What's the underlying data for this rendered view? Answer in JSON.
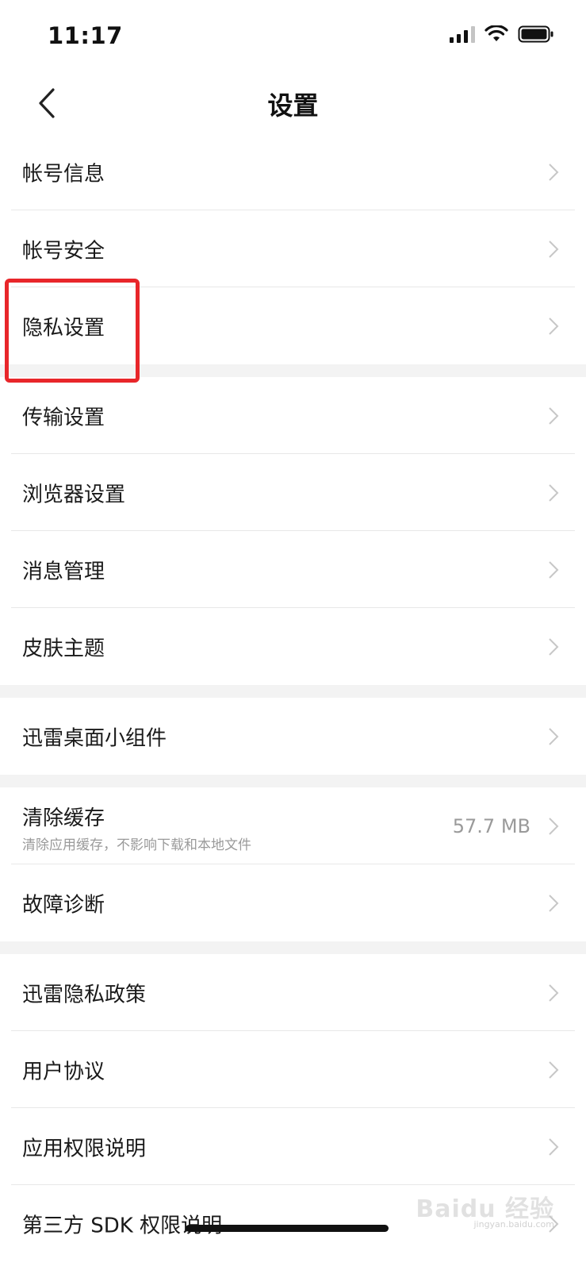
{
  "status_bar": {
    "time": "11:17"
  },
  "nav": {
    "title": "设置",
    "back_icon": "chevron-left-icon"
  },
  "groups": [
    {
      "items": [
        {
          "label": "帐号信息"
        },
        {
          "label": "帐号安全"
        },
        {
          "label": "隐私设置",
          "highlighted": true
        }
      ]
    },
    {
      "items": [
        {
          "label": "传输设置"
        },
        {
          "label": "浏览器设置"
        },
        {
          "label": "消息管理"
        },
        {
          "label": "皮肤主题"
        }
      ]
    },
    {
      "items": [
        {
          "label": "迅雷桌面小组件"
        }
      ]
    },
    {
      "items": [
        {
          "label": "清除缓存",
          "sublabel": "清除应用缓存，不影响下载和本地文件",
          "value": "57.7 MB"
        },
        {
          "label": "故障诊断"
        }
      ]
    },
    {
      "items": [
        {
          "label": "迅雷隐私政策"
        },
        {
          "label": "用户协议"
        },
        {
          "label": "应用权限说明"
        },
        {
          "label": "第三方 SDK 权限说明"
        }
      ]
    }
  ],
  "watermark": {
    "text": "Baidu 经验",
    "sub": "jingyan.baidu.com"
  },
  "colors": {
    "highlight": "#e8262a",
    "group_gap": "#f3f3f3",
    "divider": "#e8e8e8",
    "secondary_text": "#9a9a9a"
  }
}
